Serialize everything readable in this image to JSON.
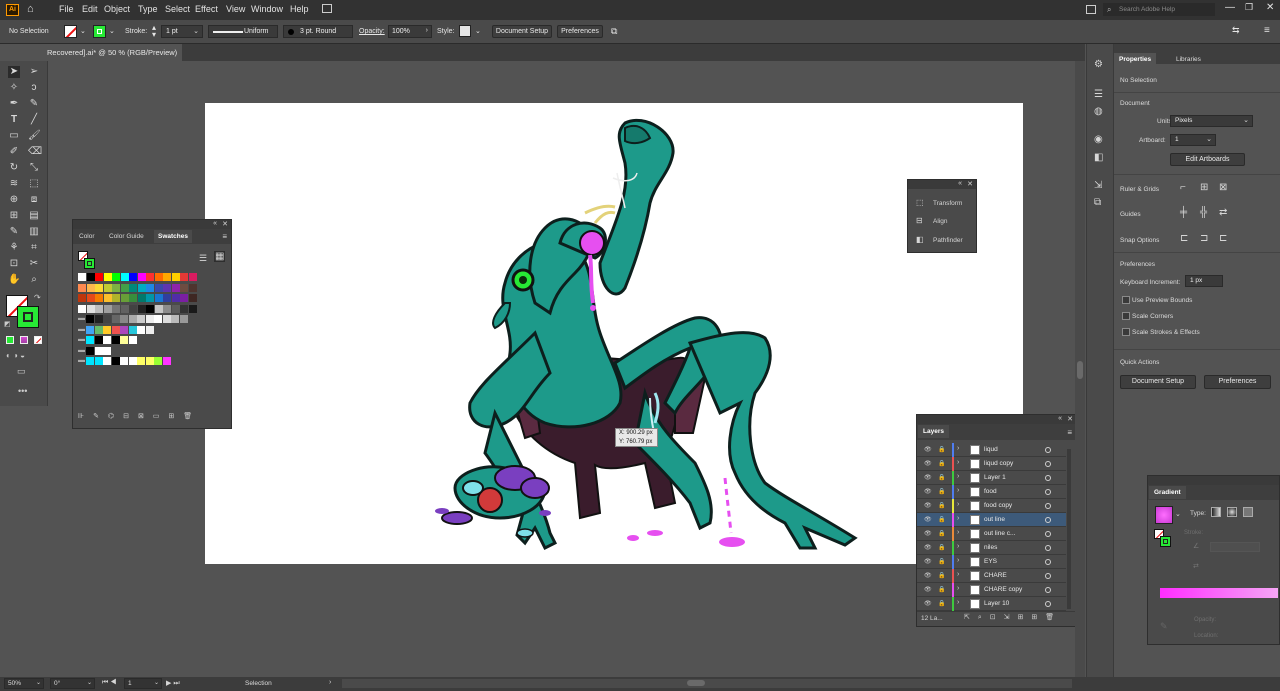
{
  "app": {
    "logo": "Ai"
  },
  "menu": [
    "File",
    "Edit",
    "Object",
    "Type",
    "Select",
    "Effect",
    "View",
    "Window",
    "Help"
  ],
  "search": {
    "placeholder": "Search Adobe Help"
  },
  "control": {
    "selection": "No Selection",
    "stroke_label": "Stroke:",
    "stroke_value": "1 pt",
    "profile": "Uniform",
    "brush": "3 pt. Round",
    "opacity_label": "Opacity:",
    "opacity_value": "100%",
    "style_label": "Style:",
    "document_setup": "Document Setup",
    "preferences": "Preferences",
    "fill_color": "#ffffff",
    "stroke_color": "#27e835"
  },
  "doc_tab": "Recovered].ai* @ 50 % (RGB/Preview)",
  "swatches_panel": {
    "tabs": [
      "Color",
      "Color Guide",
      "Swatches"
    ]
  },
  "floating_panel": {
    "items": [
      "Transform",
      "Align",
      "Pathfinder"
    ]
  },
  "tooltip": {
    "x": "X: 900.29 px",
    "y": "Y: 760.79 px"
  },
  "layers": {
    "title": "Layers",
    "count": "12 La...",
    "rows": [
      {
        "name": "liqud",
        "color": "#4f7df0"
      },
      {
        "name": "liqud copy",
        "color": "#ea5252"
      },
      {
        "name": "Layer 1",
        "color": "#3ec93e"
      },
      {
        "name": "food",
        "color": "#4f7df0"
      },
      {
        "name": "food copy",
        "color": "#e8e83a"
      },
      {
        "name": "out line",
        "color": "#e84df0"
      },
      {
        "name": "out line c...",
        "color": "#ea8a3a"
      },
      {
        "name": "niles",
        "color": "#3ec93e"
      },
      {
        "name": "EYS",
        "color": "#4f7df0"
      },
      {
        "name": "CHARE",
        "color": "#ea5252"
      },
      {
        "name": "CHARE copy",
        "color": "#e84df0"
      },
      {
        "name": "Layer 10",
        "color": "#3ec93e"
      }
    ]
  },
  "properties": {
    "tabs": [
      "Properties",
      "Libraries"
    ],
    "selection": "No Selection",
    "document": "Document",
    "units_label": "Units:",
    "units_value": "Pixels",
    "artboard_label": "Artboard:",
    "artboard_value": "1",
    "edit_artboards": "Edit Artboards",
    "rulers": "Ruler & Grids",
    "guides": "Guides",
    "snap": "Snap Options",
    "preferences": "Preferences",
    "keyboard_label": "Keyboard Increment:",
    "keyboard_value": "1 px",
    "use_preview": "Use Preview Bounds",
    "scale_corners": "Scale Corners",
    "scale_strokes": "Scale Strokes & Effects",
    "quick_actions": "Quick Actions",
    "doc_setup_btn": "Document Setup",
    "prefs_btn": "Preferences"
  },
  "gradient_panel": {
    "title": "Gradient",
    "type_label": "Type:",
    "stroke_label": "Stroke:",
    "opacity_label": "Opacity:",
    "location_label": "Location:"
  },
  "status": {
    "zoom": "50%",
    "rotation": "0°",
    "artboard": "1",
    "tool": "Selection"
  }
}
